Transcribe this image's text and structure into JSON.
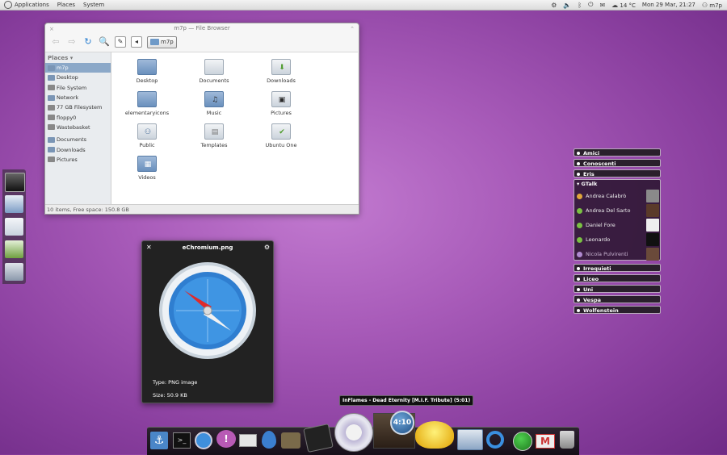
{
  "top_panel": {
    "menus": [
      "Applications",
      "Places",
      "System"
    ],
    "temperature": "14 °C",
    "datetime": "Mon 29 Mar, 21:27",
    "user": "m7p",
    "icons": [
      "gear-icon",
      "volume-icon",
      "bluetooth-icon",
      "power-icon",
      "mail-icon",
      "cloud-icon",
      "user-icon"
    ]
  },
  "file_browser": {
    "title": "m7p — File Browser",
    "path_label": "m7p",
    "places_header": "Places",
    "places": [
      "m7p",
      "Desktop",
      "File System",
      "Network",
      "77 GB Filesystem",
      "floppy0",
      "Wastebasket"
    ],
    "bookmarks": [
      "Documents",
      "Downloads",
      "Pictures"
    ],
    "items": [
      "Desktop",
      "Documents",
      "Downloads",
      "elementaryicons",
      "Music",
      "Pictures",
      "Public",
      "Templates",
      "Ubuntu One",
      "Videos"
    ],
    "status": "10 items, Free space: 150.8 GB"
  },
  "preview": {
    "title": "eChromium.png",
    "type": "Type: PNG image",
    "size": "Size: 50.9 KB"
  },
  "tooltip": "InFlames - Dead Eternity [M.I.F. Tribute] (5:01)",
  "clock": "4:10",
  "contacts": {
    "groups_top": [
      "Amici",
      "Conoscenti",
      "Eris"
    ],
    "gtalk_label": "GTalk",
    "gtalk": [
      {
        "name": "Andrea Calabrò",
        "status_color": "#e0a63a"
      },
      {
        "name": "Andrea Del Sarto",
        "status_color": "#7ac043"
      },
      {
        "name": "Daniel Fore",
        "status_color": "#7ac043"
      },
      {
        "name": "Leonardo",
        "status_color": "#7ac043"
      },
      {
        "name": "Nicola Pulvirenti",
        "status_color": "#b08ad0"
      }
    ],
    "groups_bottom": [
      "Irrequieti",
      "Liceo",
      "Uni",
      "Vespa",
      "Wolfenstein"
    ]
  },
  "dock_icons": [
    "anchor-icon",
    "terminal-icon",
    "compass-icon",
    "chat-bubble-icon",
    "mail-icon",
    "water-drop-icon",
    "gimp-icon",
    "inkscape-icon",
    "aperture-icon",
    "album-art-icon",
    "clock-icon",
    "teapot-icon",
    "file-manager-icon",
    "update-icon",
    "record-icon",
    "gmail-icon",
    "trash-icon"
  ]
}
